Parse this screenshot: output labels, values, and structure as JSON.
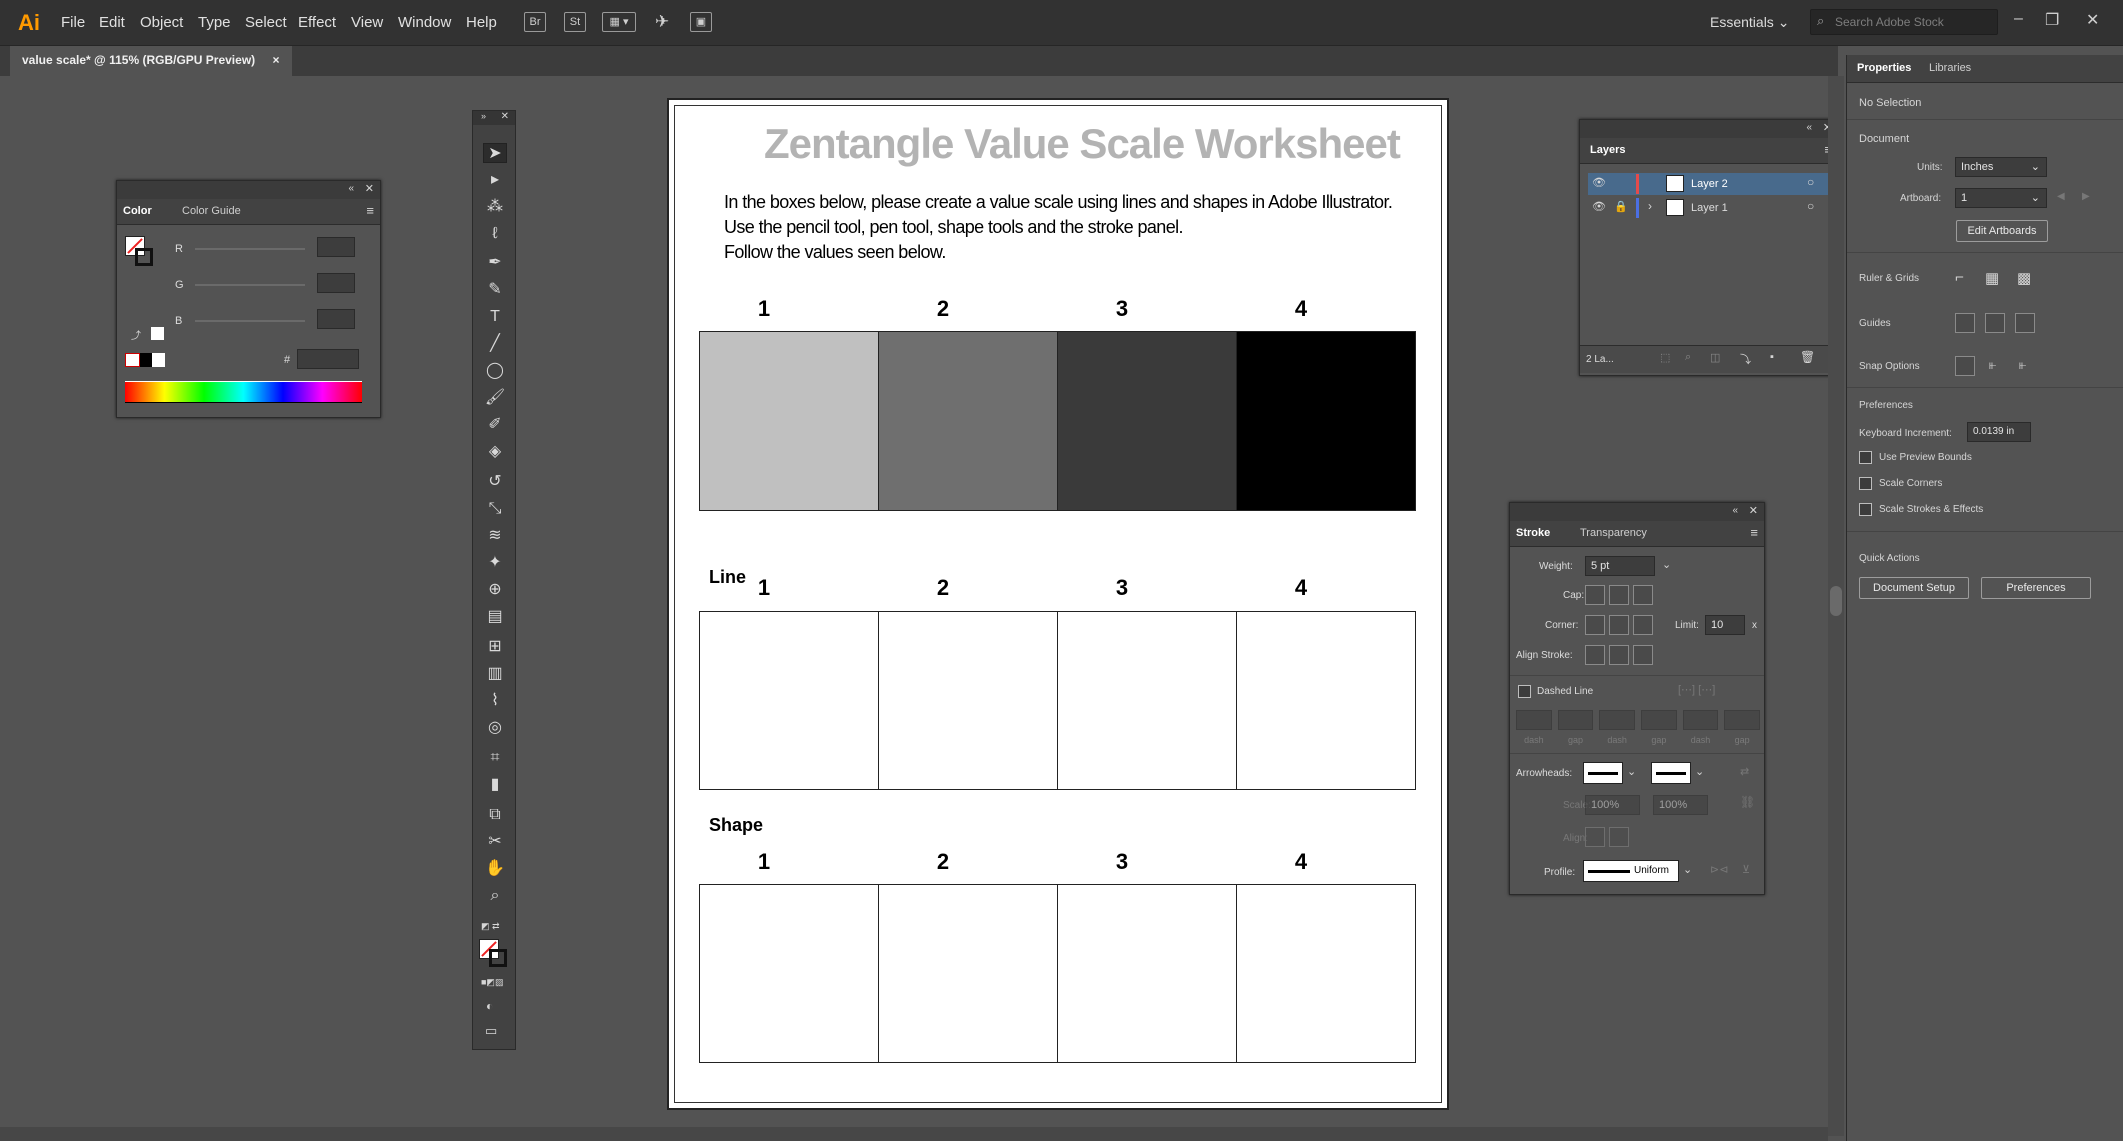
{
  "app": {
    "logo": "Ai",
    "menu": [
      "File",
      "Edit",
      "Object",
      "Type",
      "Select",
      "Effect",
      "View",
      "Window",
      "Help"
    ],
    "bridge_icons": [
      "Br",
      "St"
    ],
    "workspace": "Essentials",
    "search_placeholder": "Search Adobe Stock",
    "accent": "#ff9a00"
  },
  "document": {
    "tab_label": "value scale* @ 115% (RGB/GPU Preview)",
    "tab_close": "×"
  },
  "worksheet": {
    "title": "Zentangle Value Scale Worksheet",
    "instructions": [
      "In the boxes below, please create a value scale using lines and shapes in Adobe Illustrator.",
      "Use the pencil tool, pen tool, shape tools and the stroke panel.",
      "Follow the values seen below."
    ],
    "numbers": [
      "1",
      "2",
      "3",
      "4"
    ],
    "value_colors": [
      "#c0c0c0",
      "#6f6f6f",
      "#3a3a3a",
      "#000000"
    ],
    "line_label": "Line",
    "shape_label": "Shape"
  },
  "color_panel": {
    "tabs": [
      "Color",
      "Color Guide"
    ],
    "channels": [
      "R",
      "G",
      "B"
    ],
    "hex_symbol": "#"
  },
  "layers_panel": {
    "title": "Layers",
    "layers": [
      {
        "name": "Layer 2",
        "color": "#e34b4b"
      },
      {
        "name": "Layer 1",
        "color": "#4b6fe3"
      }
    ],
    "footer_count": "2 La..."
  },
  "stroke_panel": {
    "tabs": [
      "Stroke",
      "Transparency"
    ],
    "weight_label": "Weight:",
    "weight_value": "5 pt",
    "cap_label": "Cap:",
    "corner_label": "Corner:",
    "limit_label": "Limit:",
    "limit_value": "10",
    "limit_unit": "x",
    "align_label": "Align Stroke:",
    "dashed_label": "Dashed Line",
    "dash_gap": [
      "dash",
      "gap",
      "dash",
      "gap",
      "dash",
      "gap"
    ],
    "arrowheads_label": "Arrowheads:",
    "scale_label": "Scale:",
    "scale_value": "100%",
    "align_label2": "Align:",
    "profile_label": "Profile:",
    "profile_value": "Uniform"
  },
  "properties_panel": {
    "tabs": [
      "Properties",
      "Libraries"
    ],
    "selection": "No Selection",
    "document_head": "Document",
    "units_label": "Units:",
    "units_value": "Inches",
    "artboard_label": "Artboard:",
    "artboard_value": "1",
    "edit_artboards": "Edit Artboards",
    "ruler_grids": "Ruler & Grids",
    "guides": "Guides",
    "snap_options": "Snap Options",
    "preferences_head": "Preferences",
    "keyboard_increment_label": "Keyboard Increment:",
    "keyboard_increment_value": "0.0139 in",
    "use_preview_bounds": "Use Preview Bounds",
    "scale_corners": "Scale Corners",
    "scale_strokes": "Scale Strokes & Effects",
    "quick_actions": "Quick Actions",
    "document_setup": "Document Setup",
    "preferences_btn": "Preferences"
  }
}
